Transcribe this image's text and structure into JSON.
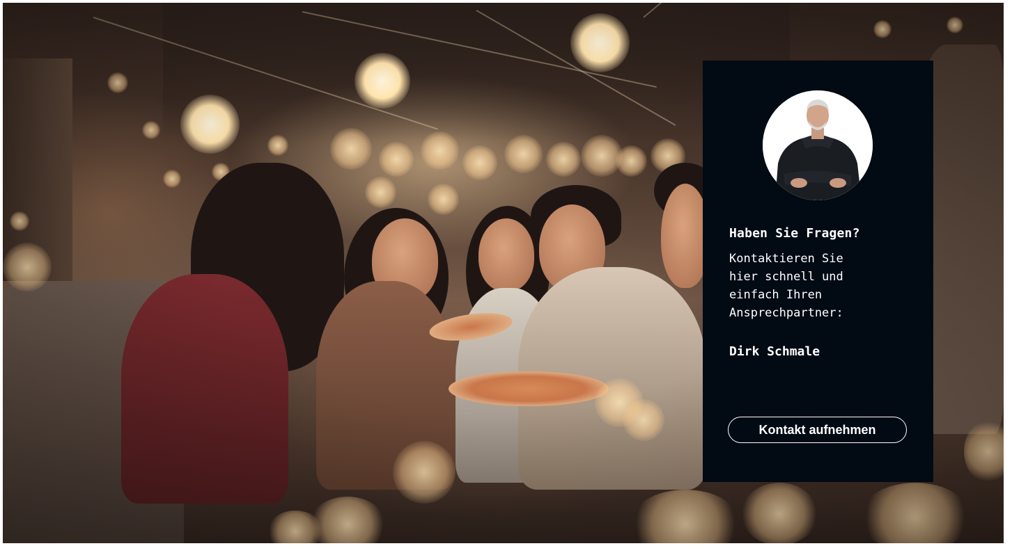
{
  "hero_image": {
    "icon": "party-photo"
  },
  "contact_card": {
    "background_color": "#020a14",
    "avatar_icon": "person-avatar",
    "heading": "Haben Sie Fragen?",
    "body": "Kontaktieren Sie\nhier schnell und\neinfach Ihren\nAnsprechpartner:",
    "contact_name": "Dirk Schmale",
    "button_label": "Kontakt aufnehmen"
  }
}
